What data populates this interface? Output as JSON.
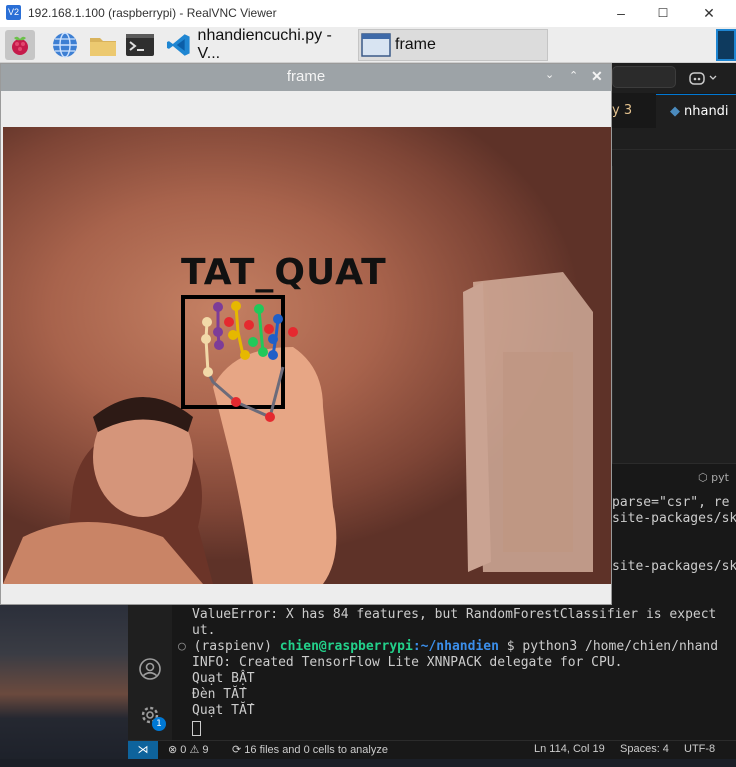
{
  "vnc": {
    "title": "192.168.1.100 (raspberrypi) - RealVNC Viewer",
    "minimize": "–",
    "maximize": "☐",
    "close": "✕"
  },
  "taskbar": {
    "tasks": [
      {
        "label": "nhandiencuchi.py - V..."
      },
      {
        "label": "frame"
      }
    ]
  },
  "frame_window": {
    "title": "frame",
    "overlay_label": "TAT_QUAT"
  },
  "vscode": {
    "tab_partial": "y 3",
    "tab_file": "nhandi",
    "panel_partial": "pyt",
    "terminal_lines": [
      "parse=\"csr\", re",
      "site-packages/sk",
      "site-packages/sk",
      "ValueError: X has 84 features, but RandomForestClassifier is expect",
      "ut.",
      "Created TensorFlow Lite XNNPACK delegate for CPU.",
      "Quạt BẬT",
      "Đèn TẮT",
      "Quạt TẮT"
    ],
    "prompt": {
      "env": "(raspienv)",
      "user": "chien@raspberrypi",
      "path": ":~/nhandien",
      "symbol": "$",
      "command": "python3 /home/chien/nhand"
    },
    "info_prefix": "INFO:",
    "accounts_badge": "1",
    "status": {
      "errors": "0",
      "warnings": "9",
      "analysis": "16 files and 0 cells to analyze",
      "position": "Ln 114, Col 19",
      "spaces": "Spaces: 4",
      "encoding": "UTF-8"
    }
  }
}
